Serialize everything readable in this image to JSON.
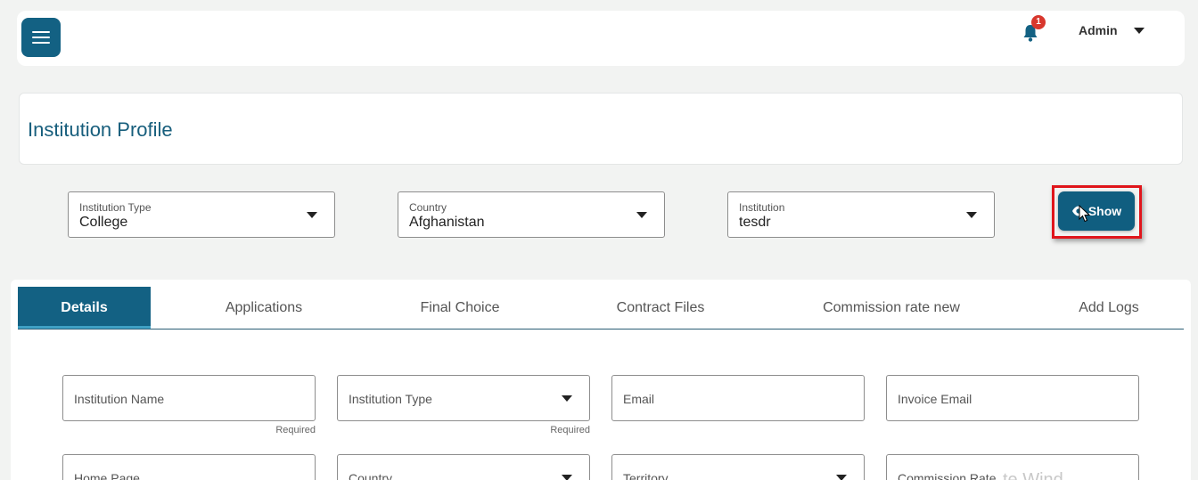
{
  "header": {
    "notifications_count": "1",
    "user_name": "Admin"
  },
  "page": {
    "title": "Institution Profile"
  },
  "filters": {
    "institution_type": {
      "label": "Institution Type",
      "value": "College"
    },
    "country": {
      "label": "Country",
      "value": "Afghanistan"
    },
    "institution": {
      "label": "Institution",
      "value": "tesdr"
    },
    "show_label": "Show"
  },
  "tabs": [
    {
      "label": "Details",
      "active": true
    },
    {
      "label": "Applications"
    },
    {
      "label": "Final Choice"
    },
    {
      "label": "Contract Files"
    },
    {
      "label": "Commission rate new"
    },
    {
      "label": "Add Logs"
    }
  ],
  "form": {
    "institution_name": {
      "placeholder": "Institution Name",
      "helper": "Required"
    },
    "institution_type": {
      "placeholder": "Institution Type",
      "helper": "Required"
    },
    "email": {
      "placeholder": "Email"
    },
    "invoice_email": {
      "placeholder": "Invoice Email"
    },
    "home_page": {
      "placeholder": "Home Page"
    },
    "country": {
      "placeholder": "Country"
    },
    "territory": {
      "placeholder": "Territory"
    },
    "commission_rate": {
      "placeholder": "Commission Rate"
    }
  },
  "watermark": "te Wind",
  "colors": {
    "primary": "#136183",
    "title": "#175e7c",
    "badge": "#d8372d",
    "highlight": "#e0151b",
    "background": "#f2f3f2"
  }
}
